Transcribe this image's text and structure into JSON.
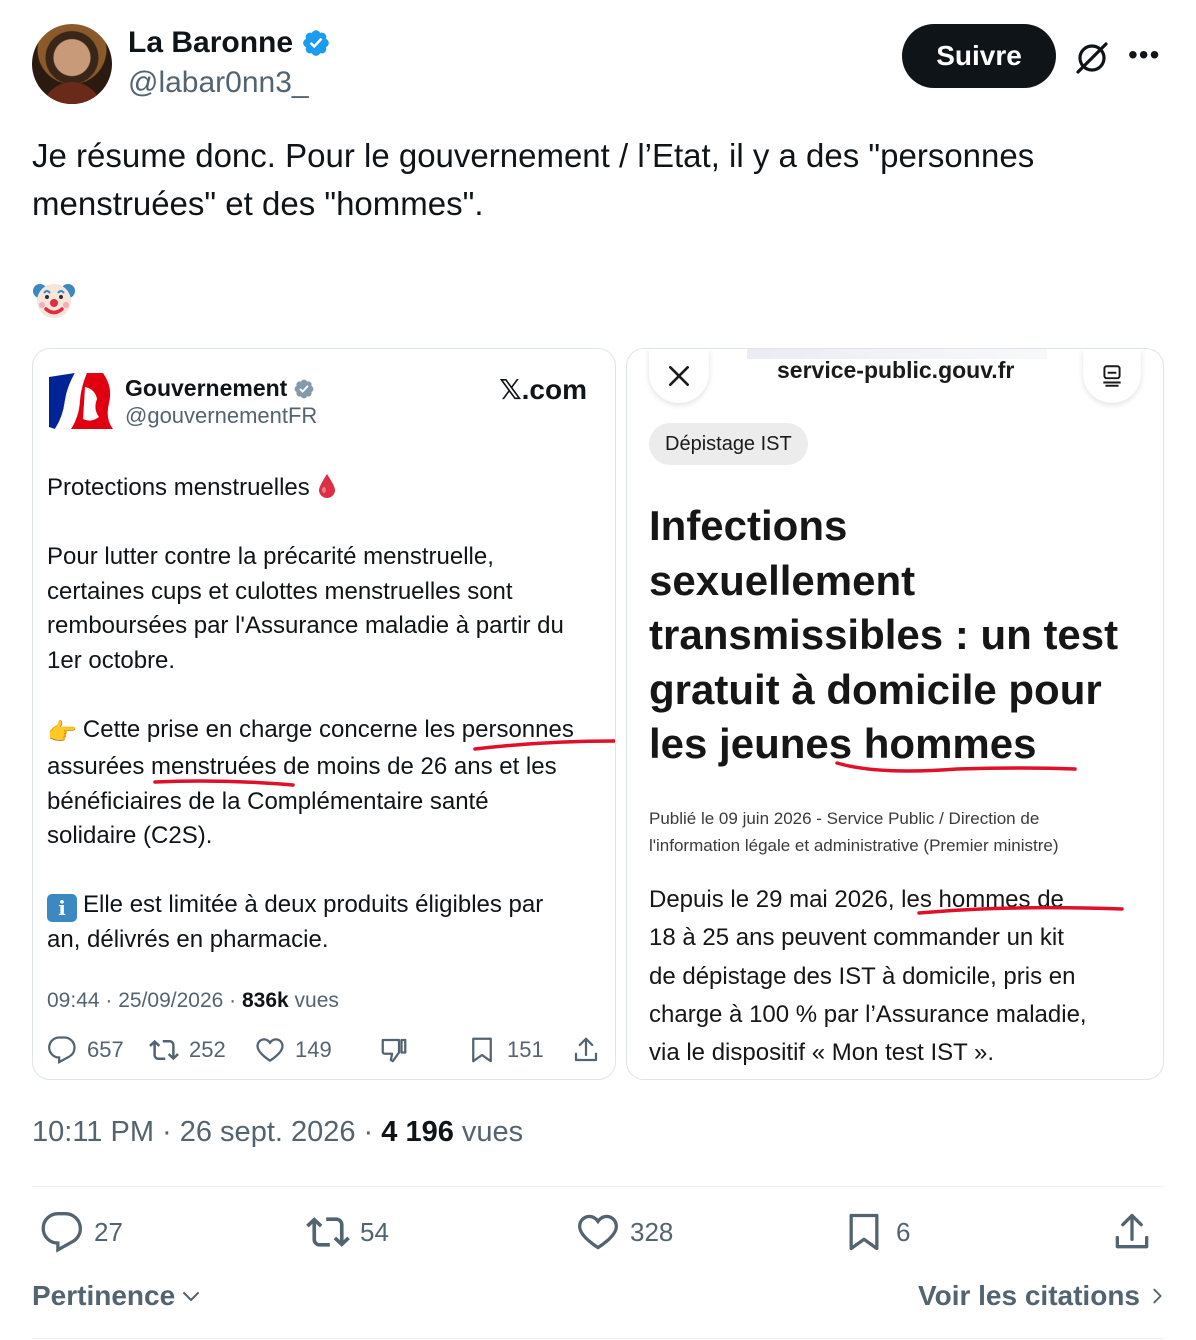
{
  "header": {
    "name": "La Baronne",
    "handle": "@labar0nn3_",
    "follow_label": "Suivre"
  },
  "tweet": {
    "text_line1": "Je résume donc. Pour le gouvernement / l’Etat, il y a des \"personnes",
    "text_line2": "menstruées\" et des \"hommes\".",
    "emoji": "clown-face"
  },
  "embedded_tweet": {
    "name": "Gouvernement",
    "handle": "@gouvernementFR",
    "site": "𝕏.com",
    "title": "Protections menstruelles",
    "p1_l1": "Pour lutter contre la précarité menstruelle,",
    "p1_l2": "certaines cups et culottes menstruelles sont",
    "p1_l3": "remboursées par l'Assurance maladie à partir du",
    "p1_l4": "1er octobre.",
    "p2_emoji": "👉",
    "p2_l1": "Cette prise en charge concerne les personnes",
    "p2_l2": "assurées menstruées de moins de 26 ans et les",
    "p2_l3": "bénéficiaires de la Complémentaire santé",
    "p2_l4": "solidaire (C2S).",
    "p3_emoji": "i",
    "p3_l1": "Elle est limitée à deux produits éligibles par",
    "p3_l2": "an, délivrés en pharmacie.",
    "time": "09:44 · 25/09/2026 · ",
    "views_count": "836k",
    "views_label": " vues",
    "replies": "657",
    "retweets": "252",
    "likes": "149",
    "bookmarks": "151"
  },
  "service_public": {
    "url": "service-public.gouv.fr",
    "tag": "Dépistage IST",
    "title_l1": "Infections",
    "title_l2": "sexuellement",
    "title_l3": "transmissibles : un test",
    "title_l4": "gratuit à domicile pour",
    "title_l5": "les jeunes hommes",
    "published_l1": "Publié le 09 juin 2026 - Service Public / Direction de",
    "published_l2": "l'information légale et administrative (Premier ministre)",
    "body_l1": "Depuis le 29 mai 2026, les hommes de",
    "body_l2": "18 à 25 ans peuvent commander un kit",
    "body_l3": "de dépistage des IST à domicile, pris en",
    "body_l4": "charge à 100 % par l’Assurance maladie,",
    "body_l5": "via le dispositif « Mon test IST »."
  },
  "meta": {
    "time": "10:11 PM · 26 sept. 2026 · ",
    "views_count": "4 196",
    "views_label": " vues"
  },
  "actions": {
    "replies": "27",
    "retweets": "54",
    "likes": "328",
    "bookmarks": "6"
  },
  "footer": {
    "sort_label": "Pertinence",
    "quotes_label": "Voir les citations"
  },
  "colors": {
    "text": "#0f1419",
    "secondary": "#536471",
    "verified": "#1d9bf0",
    "underline": "#e0102a"
  }
}
